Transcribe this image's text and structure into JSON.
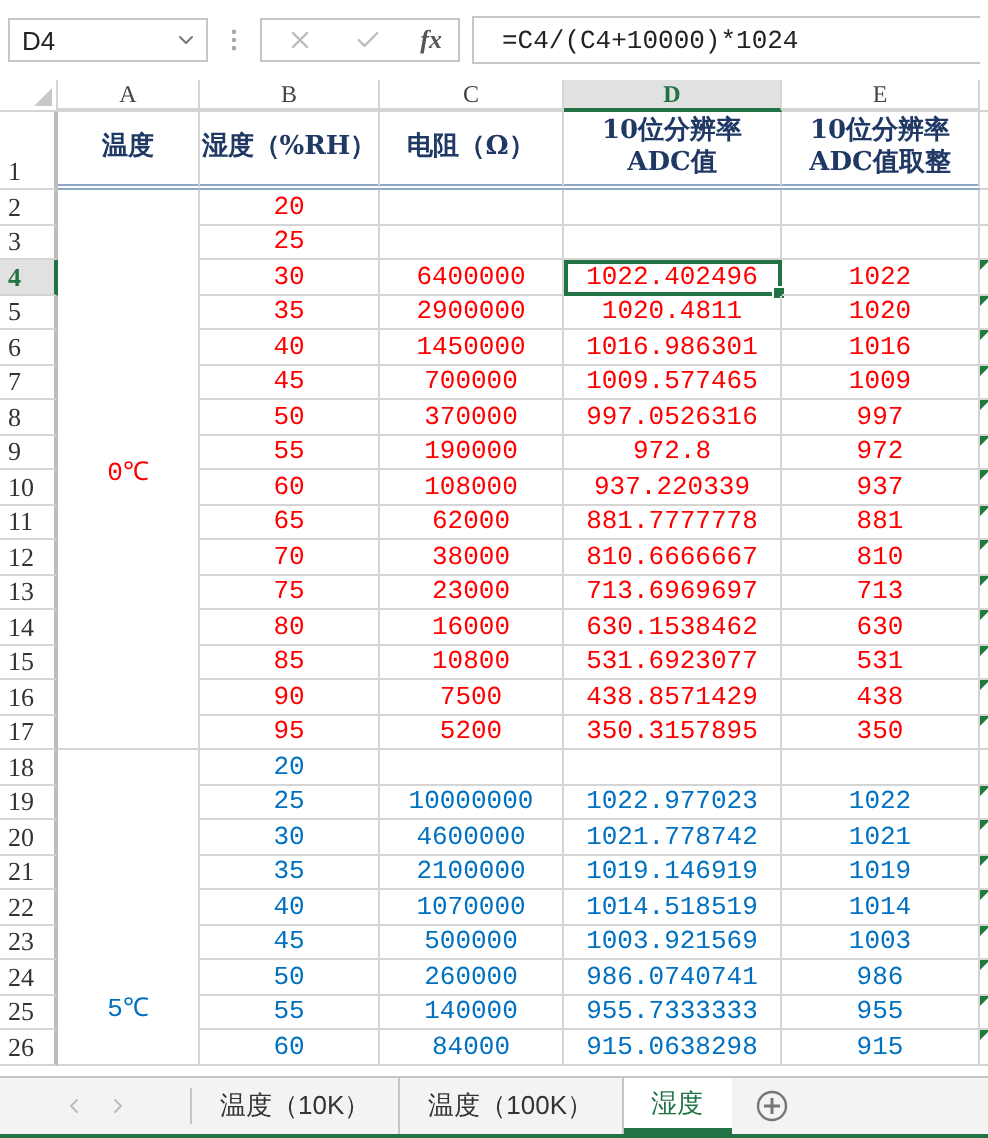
{
  "name_box": "D4",
  "function_label": "fx",
  "formula": "=C4/(C4+10000)*1024",
  "columns": [
    {
      "letter": "A",
      "selected": false
    },
    {
      "letter": "B",
      "selected": false
    },
    {
      "letter": "C",
      "selected": false
    },
    {
      "letter": "D",
      "selected": true
    },
    {
      "letter": "E",
      "selected": false
    }
  ],
  "header_row": {
    "number": "1",
    "cells": [
      {
        "lines": [
          "温度"
        ]
      },
      {
        "lines": [
          "湿度（%RH）"
        ]
      },
      {
        "lines": [
          "电阻（Ω）"
        ]
      },
      {
        "lines": [
          "10位分辨率",
          "ADC值"
        ]
      },
      {
        "lines": [
          "10位分辨率",
          "ADC值取整"
        ]
      }
    ]
  },
  "groups": [
    {
      "label": "0℃",
      "color": "#ff0000",
      "rows": [
        {
          "number": "2",
          "humidity": "20",
          "resistance": "",
          "adc": "",
          "adc_int": "",
          "selected": false,
          "flag": false
        },
        {
          "number": "3",
          "humidity": "25",
          "resistance": "",
          "adc": "",
          "adc_int": "",
          "selected": false,
          "flag": false
        },
        {
          "number": "4",
          "humidity": "30",
          "resistance": "6400000",
          "adc": "1022.402496",
          "adc_int": "1022",
          "selected": true,
          "flag": true
        },
        {
          "number": "5",
          "humidity": "35",
          "resistance": "2900000",
          "adc": "1020.4811",
          "adc_int": "1020",
          "selected": false,
          "flag": true
        },
        {
          "number": "6",
          "humidity": "40",
          "resistance": "1450000",
          "adc": "1016.986301",
          "adc_int": "1016",
          "selected": false,
          "flag": true
        },
        {
          "number": "7",
          "humidity": "45",
          "resistance": "700000",
          "adc": "1009.577465",
          "adc_int": "1009",
          "selected": false,
          "flag": true
        },
        {
          "number": "8",
          "humidity": "50",
          "resistance": "370000",
          "adc": "997.0526316",
          "adc_int": "997",
          "selected": false,
          "flag": true
        },
        {
          "number": "9",
          "humidity": "55",
          "resistance": "190000",
          "adc": "972.8",
          "adc_int": "972",
          "selected": false,
          "flag": true
        },
        {
          "number": "10",
          "humidity": "60",
          "resistance": "108000",
          "adc": "937.220339",
          "adc_int": "937",
          "selected": false,
          "flag": true
        },
        {
          "number": "11",
          "humidity": "65",
          "resistance": "62000",
          "adc": "881.7777778",
          "adc_int": "881",
          "selected": false,
          "flag": true
        },
        {
          "number": "12",
          "humidity": "70",
          "resistance": "38000",
          "adc": "810.6666667",
          "adc_int": "810",
          "selected": false,
          "flag": true
        },
        {
          "number": "13",
          "humidity": "75",
          "resistance": "23000",
          "adc": "713.6969697",
          "adc_int": "713",
          "selected": false,
          "flag": true
        },
        {
          "number": "14",
          "humidity": "80",
          "resistance": "16000",
          "adc": "630.1538462",
          "adc_int": "630",
          "selected": false,
          "flag": true
        },
        {
          "number": "15",
          "humidity": "85",
          "resistance": "10800",
          "adc": "531.6923077",
          "adc_int": "531",
          "selected": false,
          "flag": true
        },
        {
          "number": "16",
          "humidity": "90",
          "resistance": "7500",
          "adc": "438.8571429",
          "adc_int": "438",
          "selected": false,
          "flag": true
        },
        {
          "number": "17",
          "humidity": "95",
          "resistance": "5200",
          "adc": "350.3157895",
          "adc_int": "350",
          "selected": false,
          "flag": true
        }
      ]
    },
    {
      "label": "5℃",
      "color": "#0070c0",
      "rows": [
        {
          "number": "18",
          "humidity": "20",
          "resistance": "",
          "adc": "",
          "adc_int": "",
          "selected": false,
          "flag": false
        },
        {
          "number": "19",
          "humidity": "25",
          "resistance": "10000000",
          "adc": "1022.977023",
          "adc_int": "1022",
          "selected": false,
          "flag": true
        },
        {
          "number": "20",
          "humidity": "30",
          "resistance": "4600000",
          "adc": "1021.778742",
          "adc_int": "1021",
          "selected": false,
          "flag": true
        },
        {
          "number": "21",
          "humidity": "35",
          "resistance": "2100000",
          "adc": "1019.146919",
          "adc_int": "1019",
          "selected": false,
          "flag": true
        },
        {
          "number": "22",
          "humidity": "40",
          "resistance": "1070000",
          "adc": "1014.518519",
          "adc_int": "1014",
          "selected": false,
          "flag": true
        },
        {
          "number": "23",
          "humidity": "45",
          "resistance": "500000",
          "adc": "1003.921569",
          "adc_int": "1003",
          "selected": false,
          "flag": true
        },
        {
          "number": "24",
          "humidity": "50",
          "resistance": "260000",
          "adc": "986.0740741",
          "adc_int": "986",
          "selected": false,
          "flag": true
        },
        {
          "number": "25",
          "humidity": "55",
          "resistance": "140000",
          "adc": "955.7333333",
          "adc_int": "955",
          "selected": false,
          "flag": true
        },
        {
          "number": "26",
          "humidity": "60",
          "resistance": "84000",
          "adc": "915.0638298",
          "adc_int": "915",
          "selected": false,
          "flag": true
        }
      ]
    }
  ],
  "sheet_tabs": [
    {
      "label": "温度（10K）",
      "selected": false
    },
    {
      "label": "温度（100K）",
      "selected": false
    },
    {
      "label": "湿度",
      "selected": true
    }
  ]
}
